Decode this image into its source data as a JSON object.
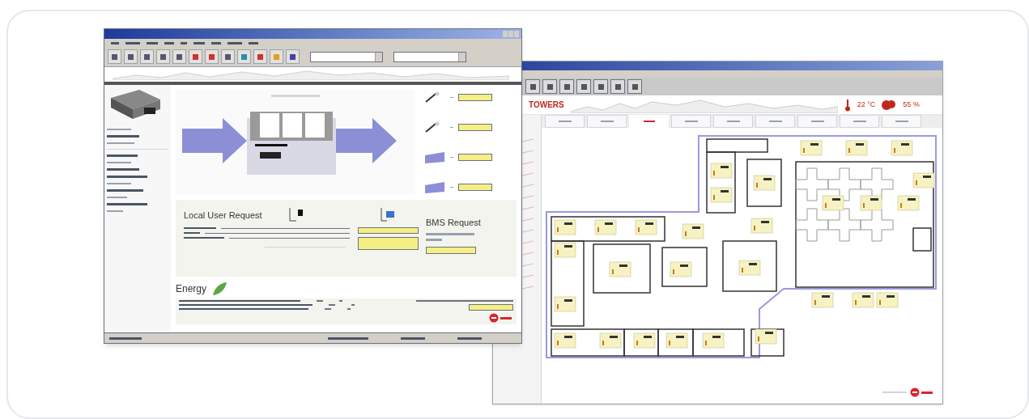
{
  "unit_window": {
    "toolbar": {
      "dropdowns": [
        {
          "kind": "dropdown"
        },
        {
          "kind": "dropdown"
        }
      ]
    },
    "local_request": {
      "title": "Local User Request"
    },
    "bms_request": {
      "title": "BMS Request"
    },
    "energy": {
      "title": "Energy"
    }
  },
  "building_window": {
    "site_name": "TOWERS",
    "temperature": "22 °C",
    "humidity": "55 %",
    "tabs": [
      {
        "selected": false
      },
      {
        "selected": false
      },
      {
        "selected": true
      },
      {
        "selected": false
      },
      {
        "selected": false
      },
      {
        "selected": false
      },
      {
        "selected": false
      },
      {
        "selected": false
      },
      {
        "selected": false
      }
    ]
  }
}
